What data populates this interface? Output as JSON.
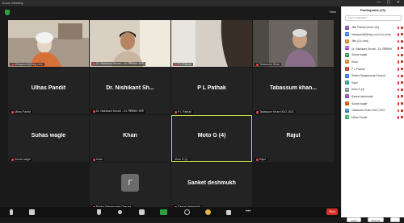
{
  "window": {
    "title": "Zoom Meeting"
  },
  "view_label": "View",
  "tiles": [
    {
      "name": "",
      "label": "ulhaspandit@dcg.com"
    },
    {
      "name": "",
      "label": "Dr. Nishikant Shrotri - Dr. निशिकांत श्रोत्री"
    },
    {
      "name": "",
      "label": "P L Pathak"
    },
    {
      "name": "",
      "label": "Tabassum Khan"
    },
    {
      "name": "Ulhas Pandit",
      "label": "Ulhas Pandit"
    },
    {
      "name": "Dr. Nishikant Sh...",
      "label": "Dr. Nishikant Shrotri - Dr. निशिकांत श्रोत्री"
    },
    {
      "name": "P L Pathak",
      "label": "P L Pathak"
    },
    {
      "name": "Tabassum khan...",
      "label": "Tabassum Khan NGO 2021"
    },
    {
      "name": "Suhas wagle",
      "label": "Suhas wagle"
    },
    {
      "name": "Khan",
      "label": "Khan"
    },
    {
      "name": "Moto G (4)",
      "label": "Moto G (4)"
    },
    {
      "name": "Rajul",
      "label": "Rajul"
    },
    {
      "name": "",
      "avatar": "Г",
      "label": "Radha Wagasvamy Desuza"
    },
    {
      "name": "Sanket deshmukh",
      "label": "Sanket deshmukh"
    }
  ],
  "panel": {
    "title": "Participants (13)",
    "search_placeholder": "Find a participant",
    "participants": [
      {
        "initials": "SP",
        "color": "#6b3fa0",
        "name": "Jitin Pathak (Host, me)"
      },
      {
        "initials": "UP",
        "color": "#2d6cdf",
        "name": "ulhaspandit@dcg.com (Co-host)"
      },
      {
        "initials": "K",
        "color": "#d9822b",
        "name": "Jitin (Co-host)"
      },
      {
        "initials": "DN",
        "color": "#9b3fd1",
        "name": "Dr. Nishikant Shrotri - Dr. निशिकांत"
      },
      {
        "initials": "SP",
        "color": "#2d8a4e",
        "name": "Suhas wagle"
      },
      {
        "initials": "K",
        "color": "#d9822b",
        "name": "Khan"
      },
      {
        "initials": "P",
        "color": "#c0392b",
        "name": "P L Pathak"
      },
      {
        "initials": "R",
        "color": "#2d6cdf",
        "name": "Radha Wagasvamy Desuza"
      },
      {
        "initials": "R",
        "color": "#16a085",
        "name": "Rajul"
      },
      {
        "initials": "M",
        "color": "#7f8c8d",
        "name": "Moto G (4)"
      },
      {
        "initials": "S",
        "color": "#8e44ad",
        "name": "Sanket deshmukh"
      },
      {
        "initials": "T",
        "color": "#d35400",
        "name": "Suhas wagle"
      },
      {
        "initials": "TK",
        "color": "#2980b9",
        "name": "Tabassum Khan NGO 2021"
      },
      {
        "initials": "UP",
        "color": "#27ae60",
        "name": "Ulhas Pandit"
      }
    ],
    "invite_label": "Invite",
    "mute_all_label": "Mute All",
    "more_label": "..."
  },
  "toolbar": {
    "end_label": "End"
  },
  "icons": [
    "mic-icon",
    "video-icon",
    "security-icon",
    "participants-icon",
    "chat-icon",
    "share-screen-icon",
    "record-icon",
    "reactions-icon",
    "apps-icon",
    "more-icon"
  ]
}
